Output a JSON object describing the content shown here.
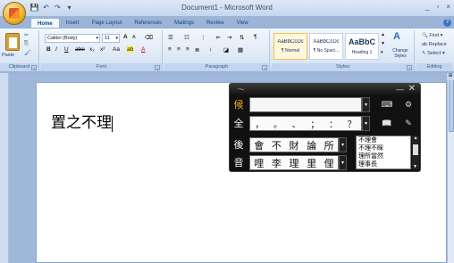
{
  "window": {
    "title": "Document1 - Microsoft Word",
    "controls": [
      "_",
      "▫",
      "×"
    ]
  },
  "quick_access": [
    "💾",
    "↶",
    "↷",
    "▾"
  ],
  "tabs": [
    "Home",
    "Insert",
    "Page Layout",
    "References",
    "Mailings",
    "Review",
    "View"
  ],
  "ribbon": {
    "clipboard": {
      "label": "Clipboard",
      "paste": "Paste"
    },
    "font": {
      "label": "Font",
      "font_name": "Calibri (Body)",
      "font_size": "11",
      "grow": "A",
      "shrink": "A",
      "bold": "B",
      "italic": "I",
      "underline": "U",
      "strike": "abe",
      "subscript": "x₂",
      "superscript": "x²",
      "case": "Aa",
      "highlight": "ab",
      "color": "A"
    },
    "paragraph": {
      "label": "Paragraph"
    },
    "styles": {
      "label": "Styles",
      "items": [
        {
          "sample": "AaBbCcDc",
          "name": "¶ Normal"
        },
        {
          "sample": "AaBbCcDc",
          "name": "¶ No Spaci..."
        },
        {
          "sample": "AaBbC",
          "name": "Heading 1"
        }
      ],
      "change_styles": "Change Styles"
    },
    "editing": {
      "label": "Editing",
      "find": "Find",
      "replace": "Replace",
      "select": "Select"
    }
  },
  "document": {
    "text": "置之不理"
  },
  "ime": {
    "label_candidate": "候",
    "label_full": "全",
    "label_after": "後",
    "label_sound": "音",
    "punctuation": [
      "，",
      "。",
      "、",
      "；",
      "：",
      "？"
    ],
    "after_chars": [
      "會",
      "不",
      "財",
      "論",
      "所"
    ],
    "sound_chars": [
      "哩",
      "李",
      "理",
      "里",
      "俚"
    ],
    "phrases": [
      "不理會",
      "不理不睬",
      "理所當然",
      "理事長"
    ]
  },
  "colors": {
    "ribbon_bg": "#d9e5f5",
    "accent_blue": "#15428b",
    "ime_bg": "#111111",
    "ime_orange": "#f5a52a"
  }
}
